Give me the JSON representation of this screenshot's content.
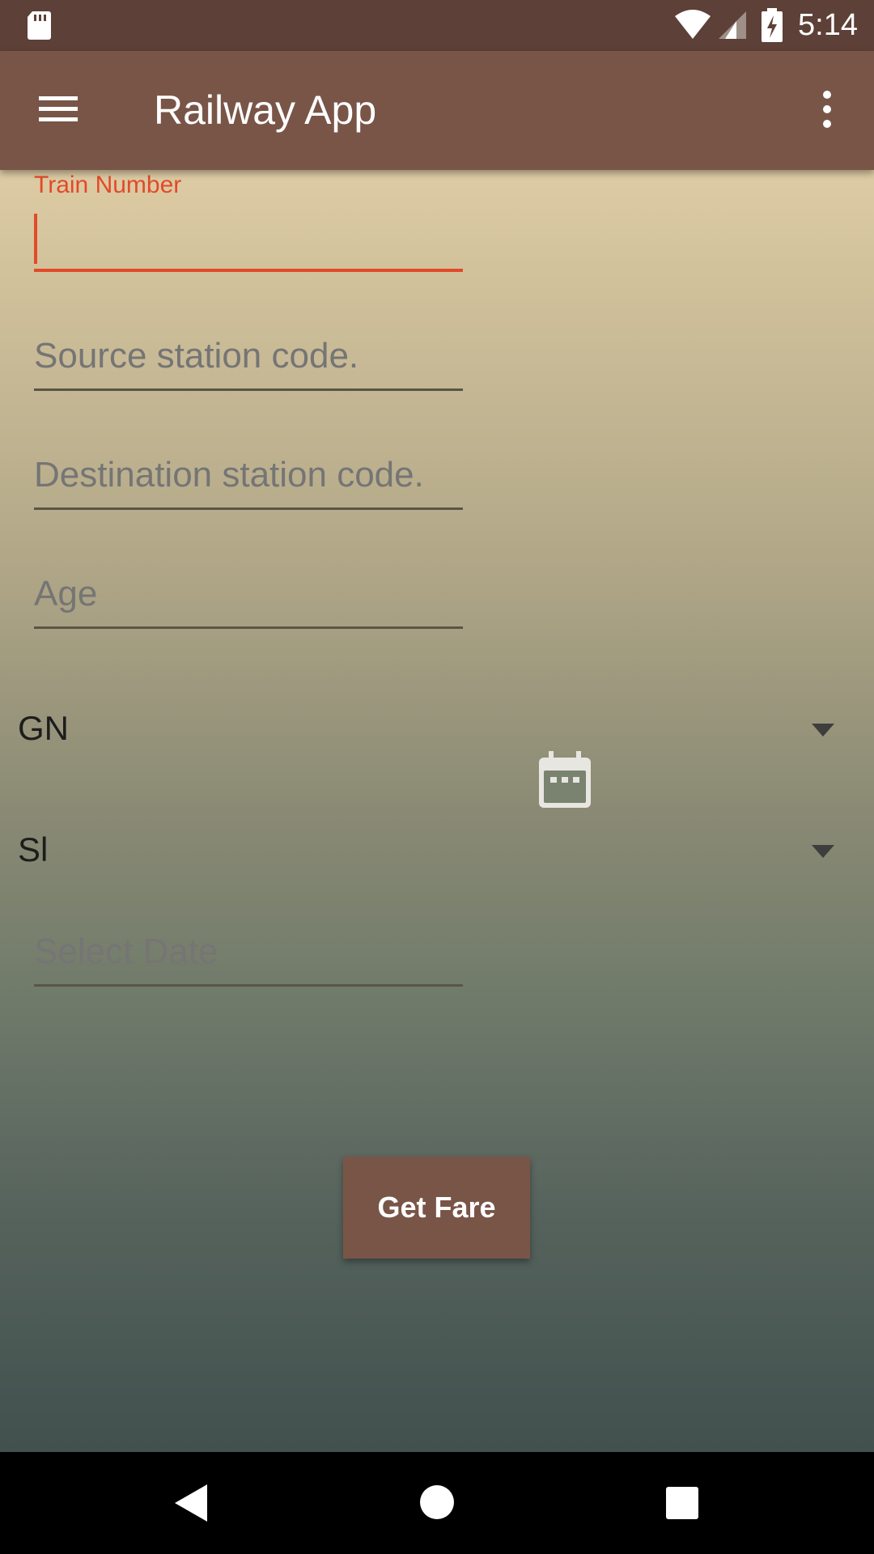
{
  "status_bar": {
    "time": "5:14",
    "icons": [
      "sd-card-icon",
      "wifi-icon",
      "signal-icon",
      "battery-charging-icon"
    ]
  },
  "app_bar": {
    "title": "Railway App",
    "menu_icon": "hamburger-menu-icon",
    "overflow_icon": "more-vert-icon"
  },
  "form": {
    "train_number": {
      "label": "Train Number",
      "value": ""
    },
    "source": {
      "placeholder": "Source station code.",
      "value": ""
    },
    "destination": {
      "placeholder": "Destination station code.",
      "value": ""
    },
    "age": {
      "placeholder": "Age",
      "value": ""
    },
    "quota": {
      "selected": "GN"
    },
    "class": {
      "selected": "Sl"
    },
    "date": {
      "placeholder": "Select Date",
      "value": ""
    },
    "calendar_icon": "calendar-icon",
    "submit_label": "Get Fare"
  },
  "nav_bar": {
    "icons": [
      "back-icon",
      "home-icon",
      "recents-icon"
    ]
  },
  "colors": {
    "status_bar": "#5d4037",
    "app_bar": "#795548",
    "accent": "#e24a2a",
    "button": "#795548"
  }
}
